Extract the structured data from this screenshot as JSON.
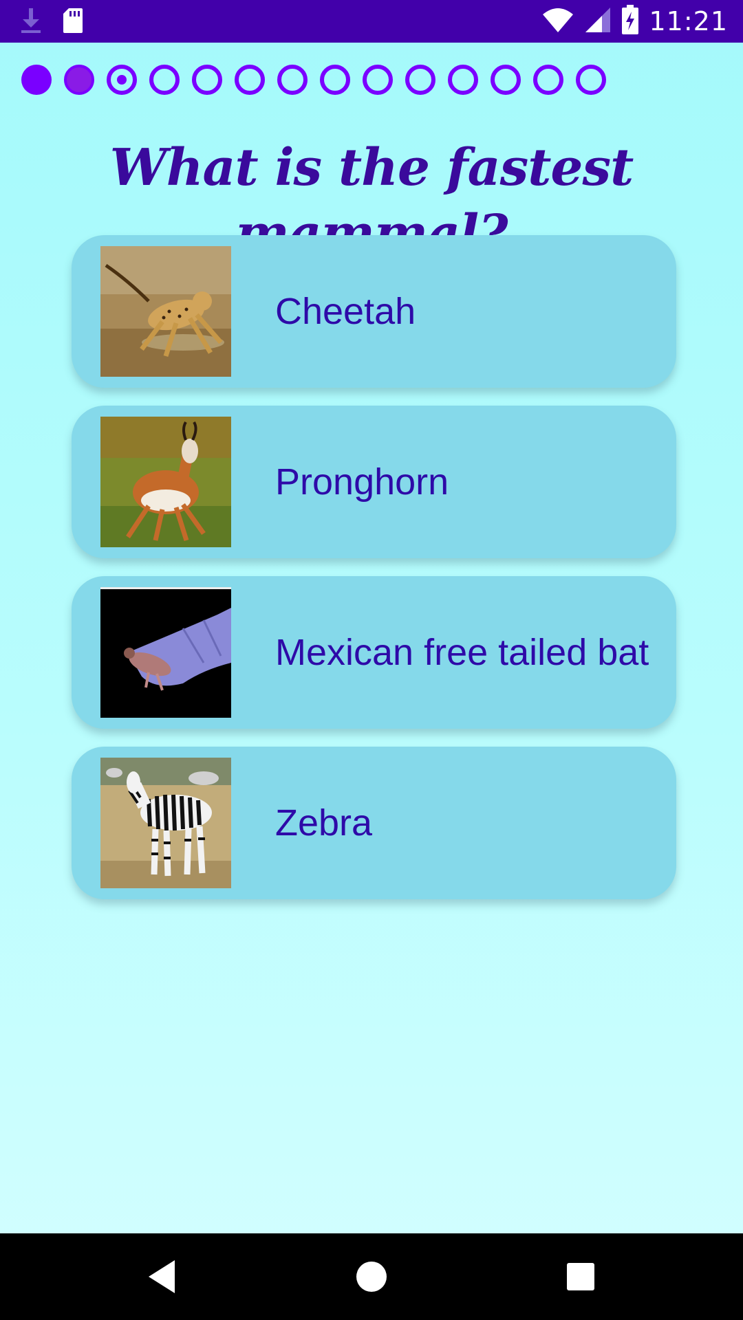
{
  "status_bar": {
    "time": "11:21",
    "icons": [
      "download-icon",
      "sd-card-icon",
      "wifi-icon",
      "signal-icon",
      "battery-charging-icon"
    ]
  },
  "progress": {
    "total": 14,
    "completed": 2,
    "current_index": 3
  },
  "question": {
    "text": "What is the fastest mammal?"
  },
  "answers": [
    {
      "label": "Cheetah",
      "image": "cheetah-image"
    },
    {
      "label": "Pronghorn",
      "image": "pronghorn-image"
    },
    {
      "label": "Mexican free tailed bat",
      "image": "bat-image"
    },
    {
      "label": "Zebra",
      "image": "zebra-image"
    }
  ],
  "nav_bar": {
    "buttons": [
      "back-icon",
      "home-icon",
      "recents-icon"
    ]
  },
  "colors": {
    "accent": "#7a00ff",
    "status_bar": "#4200aa",
    "question_text": "#3a0a9c",
    "card": "#85d9ea"
  }
}
